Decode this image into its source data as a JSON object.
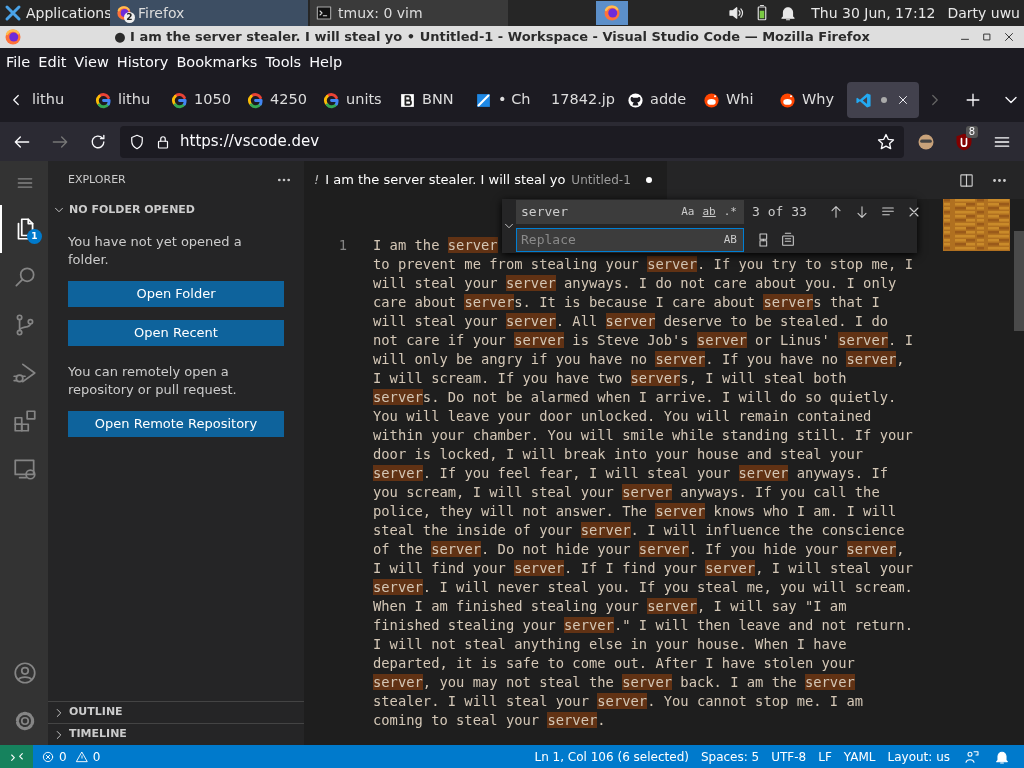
{
  "panel": {
    "apps_label": "Applications",
    "tasks": [
      {
        "label": "Firefox",
        "kind": "firefox",
        "badge": "2",
        "selected": true
      },
      {
        "label": "tmux: 0 vim",
        "kind": "terminal",
        "selected": false
      }
    ],
    "clock": "Thu 30 Jun, 17:12",
    "user": "Darty uwu"
  },
  "window": {
    "title": "● I am the server stealer. I will steal yo • Untitled-1 - Workspace - Visual Studio Code — Mozilla Firefox"
  },
  "menu": [
    "File",
    "Edit",
    "View",
    "History",
    "Bookmarks",
    "Tools",
    "Help"
  ],
  "tabs": [
    {
      "label": "lithu",
      "kind": "plain",
      "selected": false
    },
    {
      "label": "lithu",
      "kind": "google",
      "selected": false
    },
    {
      "label": "1050",
      "kind": "google",
      "selected": false
    },
    {
      "label": "4250",
      "kind": "google",
      "selected": false
    },
    {
      "label": "units",
      "kind": "google",
      "selected": false
    },
    {
      "label": "BNN",
      "kind": "bnn",
      "selected": false
    },
    {
      "label": "• Ch",
      "kind": "bluesite",
      "selected": false
    },
    {
      "label": "17842.jp",
      "kind": "plain",
      "selected": false
    },
    {
      "label": "adde",
      "kind": "github",
      "selected": false
    },
    {
      "label": "Whi",
      "kind": "reddit",
      "selected": false
    },
    {
      "label": "Why",
      "kind": "reddit",
      "selected": false
    },
    {
      "kind": "vscode",
      "selected": true,
      "modified": true
    }
  ],
  "address": {
    "url": "https://vscode.dev",
    "addon_badge": "8"
  },
  "activity": [
    {
      "kind": "menu",
      "selected": false
    },
    {
      "kind": "explorer",
      "selected": true,
      "badge": "1"
    },
    {
      "kind": "search",
      "selected": false
    },
    {
      "kind": "scm",
      "selected": false
    },
    {
      "kind": "debug",
      "selected": false
    },
    {
      "kind": "extensions",
      "selected": false
    },
    {
      "kind": "remote",
      "selected": false
    }
  ],
  "activity_bottom": [
    {
      "kind": "account"
    },
    {
      "kind": "settings"
    }
  ],
  "sidebar": {
    "title": "EXPLORER",
    "section": "NO FOLDER OPENED",
    "blocks": [
      {
        "kind": "text",
        "text": "You have not yet opened a folder."
      },
      {
        "kind": "button",
        "text": "Open Folder"
      },
      {
        "kind": "button",
        "text": "Open Recent"
      },
      {
        "kind": "text",
        "text": "You can remotely open a repository or pull request."
      },
      {
        "kind": "button",
        "text": "Open Remote Repository"
      }
    ],
    "panels": [
      {
        "label": "OUTLINE",
        "expanded": false
      },
      {
        "label": "TIMELINE",
        "expanded": false
      }
    ]
  },
  "editor": {
    "tab": {
      "prefix": "!",
      "label": "I am the server stealer. I will steal yo",
      "description": "Untitled-1",
      "modified": true
    },
    "find": {
      "query": "server",
      "count": "3 of 33",
      "replace_placeholder": "Replace",
      "toggles": [
        {
          "label": "Aa",
          "selected": false
        },
        {
          "label": "ab",
          "selected": false
        },
        {
          "label": ".*",
          "selected": false
        }
      ],
      "preserve_case": {
        "label": "AB",
        "selected": false
      }
    },
    "line_number": "1",
    "lines": [
      [
        {
          "text": "I am the ",
          "match": false
        },
        {
          "text": "server",
          "match": true
        }
      ],
      [
        {
          "text": "to prevent me from stealing your ",
          "match": false
        },
        {
          "text": "server",
          "match": true
        },
        {
          "text": ". If you try to stop me, I",
          "match": false
        }
      ],
      [
        {
          "text": "will steal your ",
          "match": false
        },
        {
          "text": "server",
          "match": true
        },
        {
          "text": " anyways. I do not care about you. I only",
          "match": false
        }
      ],
      [
        {
          "text": "care about ",
          "match": false
        },
        {
          "text": "server",
          "match": true
        },
        {
          "text": "s. It is because I care about ",
          "match": false
        },
        {
          "text": "server",
          "match": true
        },
        {
          "text": "s that I",
          "match": false
        }
      ],
      [
        {
          "text": "will steal your ",
          "match": false
        },
        {
          "text": "server",
          "match": true
        },
        {
          "text": ". All ",
          "match": false
        },
        {
          "text": "server",
          "match": true
        },
        {
          "text": " deserve to be stealed. I do",
          "match": false
        }
      ],
      [
        {
          "text": "not care if your ",
          "match": false
        },
        {
          "text": "server",
          "match": true
        },
        {
          "text": " is Steve Job's ",
          "match": false
        },
        {
          "text": "server",
          "match": true
        },
        {
          "text": " or Linus' ",
          "match": false
        },
        {
          "text": "server",
          "match": true
        },
        {
          "text": ". I",
          "match": false
        }
      ],
      [
        {
          "text": "will only be angry if you have no ",
          "match": false
        },
        {
          "text": "server",
          "match": true
        },
        {
          "text": ". If you have no ",
          "match": false
        },
        {
          "text": "server",
          "match": true
        },
        {
          "text": ",",
          "match": false
        }
      ],
      [
        {
          "text": "I will scream. If you have two ",
          "match": false
        },
        {
          "text": "server",
          "match": true
        },
        {
          "text": "s, I will steal both",
          "match": false
        }
      ],
      [
        {
          "text": "server",
          "match": true
        },
        {
          "text": "s. Do not be alarmed when I arrive. I will do so quietly.",
          "match": false
        }
      ],
      [
        {
          "text": "You will leave your door unlocked. You will remain contained",
          "match": false
        }
      ],
      [
        {
          "text": "within your chamber. You will smile while standing still. If your",
          "match": false
        }
      ],
      [
        {
          "text": "door is locked, I will break into your house and steal your",
          "match": false
        }
      ],
      [
        {
          "text": "server",
          "match": true
        },
        {
          "text": ". If you feel fear, I will steal your ",
          "match": false
        },
        {
          "text": "server",
          "match": true
        },
        {
          "text": " anyways. If",
          "match": false
        }
      ],
      [
        {
          "text": "you scream, I will steal your ",
          "match": false
        },
        {
          "text": "server",
          "match": true
        },
        {
          "text": " anyways. If you call the",
          "match": false
        }
      ],
      [
        {
          "text": "police, they will not answer. The ",
          "match": false
        },
        {
          "text": "server",
          "match": true
        },
        {
          "text": " knows who I am. I will",
          "match": false
        }
      ],
      [
        {
          "text": "steal the inside of your ",
          "match": false
        },
        {
          "text": "server",
          "match": true
        },
        {
          "text": ". I will influence the conscience",
          "match": false
        }
      ],
      [
        {
          "text": "of the ",
          "match": false
        },
        {
          "text": "server",
          "match": true
        },
        {
          "text": ". Do not hide your ",
          "match": false
        },
        {
          "text": "server",
          "match": true
        },
        {
          "text": ". If you hide your ",
          "match": false
        },
        {
          "text": "server",
          "match": true
        },
        {
          "text": ",",
          "match": false
        }
      ],
      [
        {
          "text": "I will find your ",
          "match": false
        },
        {
          "text": "server",
          "match": true
        },
        {
          "text": ". If I find your ",
          "match": false
        },
        {
          "text": "server",
          "match": true
        },
        {
          "text": ", I will steal your",
          "match": false
        }
      ],
      [
        {
          "text": "server",
          "match": true
        },
        {
          "text": ". I will never steal you. If you steal me, you will scream.",
          "match": false
        }
      ],
      [
        {
          "text": "When I am finished stealing your ",
          "match": false
        },
        {
          "text": "server",
          "match": true
        },
        {
          "text": ", I will say \"I am",
          "match": false
        }
      ],
      [
        {
          "text": "finished stealing your ",
          "match": false
        },
        {
          "text": "server",
          "match": true
        },
        {
          "text": ".\" I will then leave and not return.",
          "match": false
        }
      ],
      [
        {
          "text": "I will not steal anything else in your house. When I have",
          "match": false
        }
      ],
      [
        {
          "text": "departed, it is safe to come out. After I have stolen your",
          "match": false
        }
      ],
      [
        {
          "text": "server",
          "match": true
        },
        {
          "text": ", you may not steal the ",
          "match": false
        },
        {
          "text": "server",
          "match": true
        },
        {
          "text": " back. I am the ",
          "match": false
        },
        {
          "text": "server",
          "match": true
        }
      ],
      [
        {
          "text": "stealer. I will steal your ",
          "match": false
        },
        {
          "text": "server",
          "match": true
        },
        {
          "text": ". You cannot stop me. I am",
          "match": false
        }
      ],
      [
        {
          "text": "coming to steal your ",
          "match": false
        },
        {
          "text": "server",
          "match": true
        },
        {
          "text": ".",
          "match": false
        }
      ]
    ]
  },
  "status": {
    "errors": "0",
    "warnings": "0",
    "items": [
      "Ln 1, Col 106 (6 selected)",
      "Spaces: 5",
      "UTF-8",
      "LF",
      "YAML",
      "Layout: us"
    ]
  }
}
